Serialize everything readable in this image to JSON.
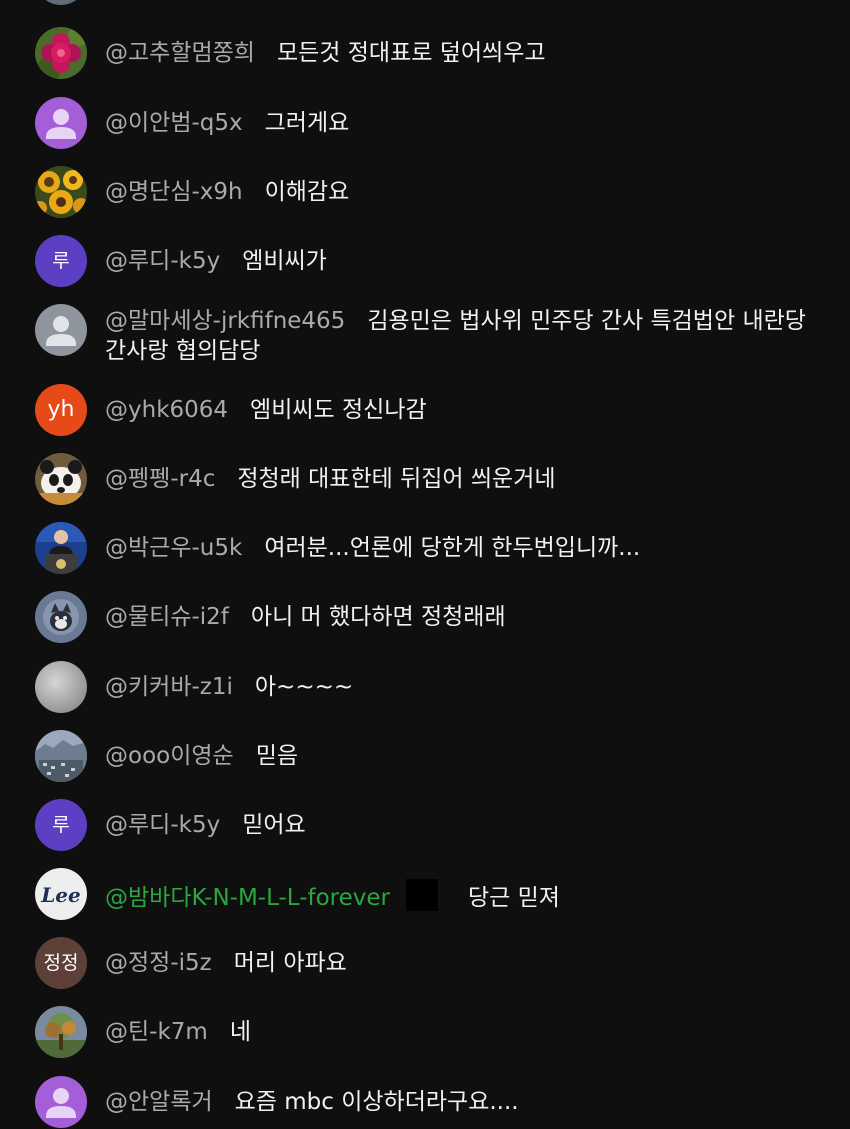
{
  "colors": {
    "background": "#0f0f0f",
    "author": "#aaaaaa",
    "member_author": "#2ba640",
    "message": "#f1f1f1"
  },
  "messages": [
    {
      "author": "@고추할멈쫑희",
      "text": "모든것 정대표로 덮어씌우고",
      "avatar": "flower-photo"
    },
    {
      "author": "@이안범-q5x",
      "text": "그러게요",
      "avatar": "default-person-purple"
    },
    {
      "author": "@명단심-x9h",
      "text": "이해감요",
      "avatar": "sunflower-photo"
    },
    {
      "author": "@루디-k5y",
      "text": "엠비씨가",
      "avatar_initial": "루",
      "avatar_color": "#5c3fc2"
    },
    {
      "author": "@말마세상-jrkfifne465",
      "text": "김용민은 법사위 민주당 간사 특검법안 내란당간사랑 협의담당",
      "avatar": "default-person-gray"
    },
    {
      "author": "@yhk6064",
      "text": "엠비씨도 정신나감",
      "avatar_initial": "yh",
      "avatar_color": "#e64a19"
    },
    {
      "author": "@펭펭-r4c",
      "text": "정청래 대표한테 뒤집어 씌운거네",
      "avatar": "panda-photo"
    },
    {
      "author": "@박근우-u5k",
      "text": "여러분...언론에 당한게 한두번입니까...",
      "avatar": "podium-photo"
    },
    {
      "author": "@물티슈-i2f",
      "text": "아니 머 했다하면 정청래래",
      "avatar": "cat-photo"
    },
    {
      "author": "@키커바-z1i",
      "text": "아~~~~",
      "avatar": "gray-photo"
    },
    {
      "author": "@ooo이영순",
      "text": "믿음",
      "avatar": "city-photo"
    },
    {
      "author": "@루디-k5y",
      "text": "믿어요",
      "avatar_initial": "루",
      "avatar_color": "#5c3fc2"
    },
    {
      "author": "@밤바다K-N-M-L-L-forever",
      "text": "당근 믿져",
      "avatar": "lee-logo",
      "avatar_logo_text": "Lee",
      "member": true
    },
    {
      "author": "@정정-i5z",
      "text": "머리 아파요",
      "avatar_initial": "정정",
      "avatar_color": "#5d4037"
    },
    {
      "author": "@틴-k7m",
      "text": "네",
      "avatar": "tree-photo"
    },
    {
      "author": "@안알록거",
      "text": "요즘 mbc 이상하더라구요....",
      "avatar": "default-person-purple"
    }
  ]
}
